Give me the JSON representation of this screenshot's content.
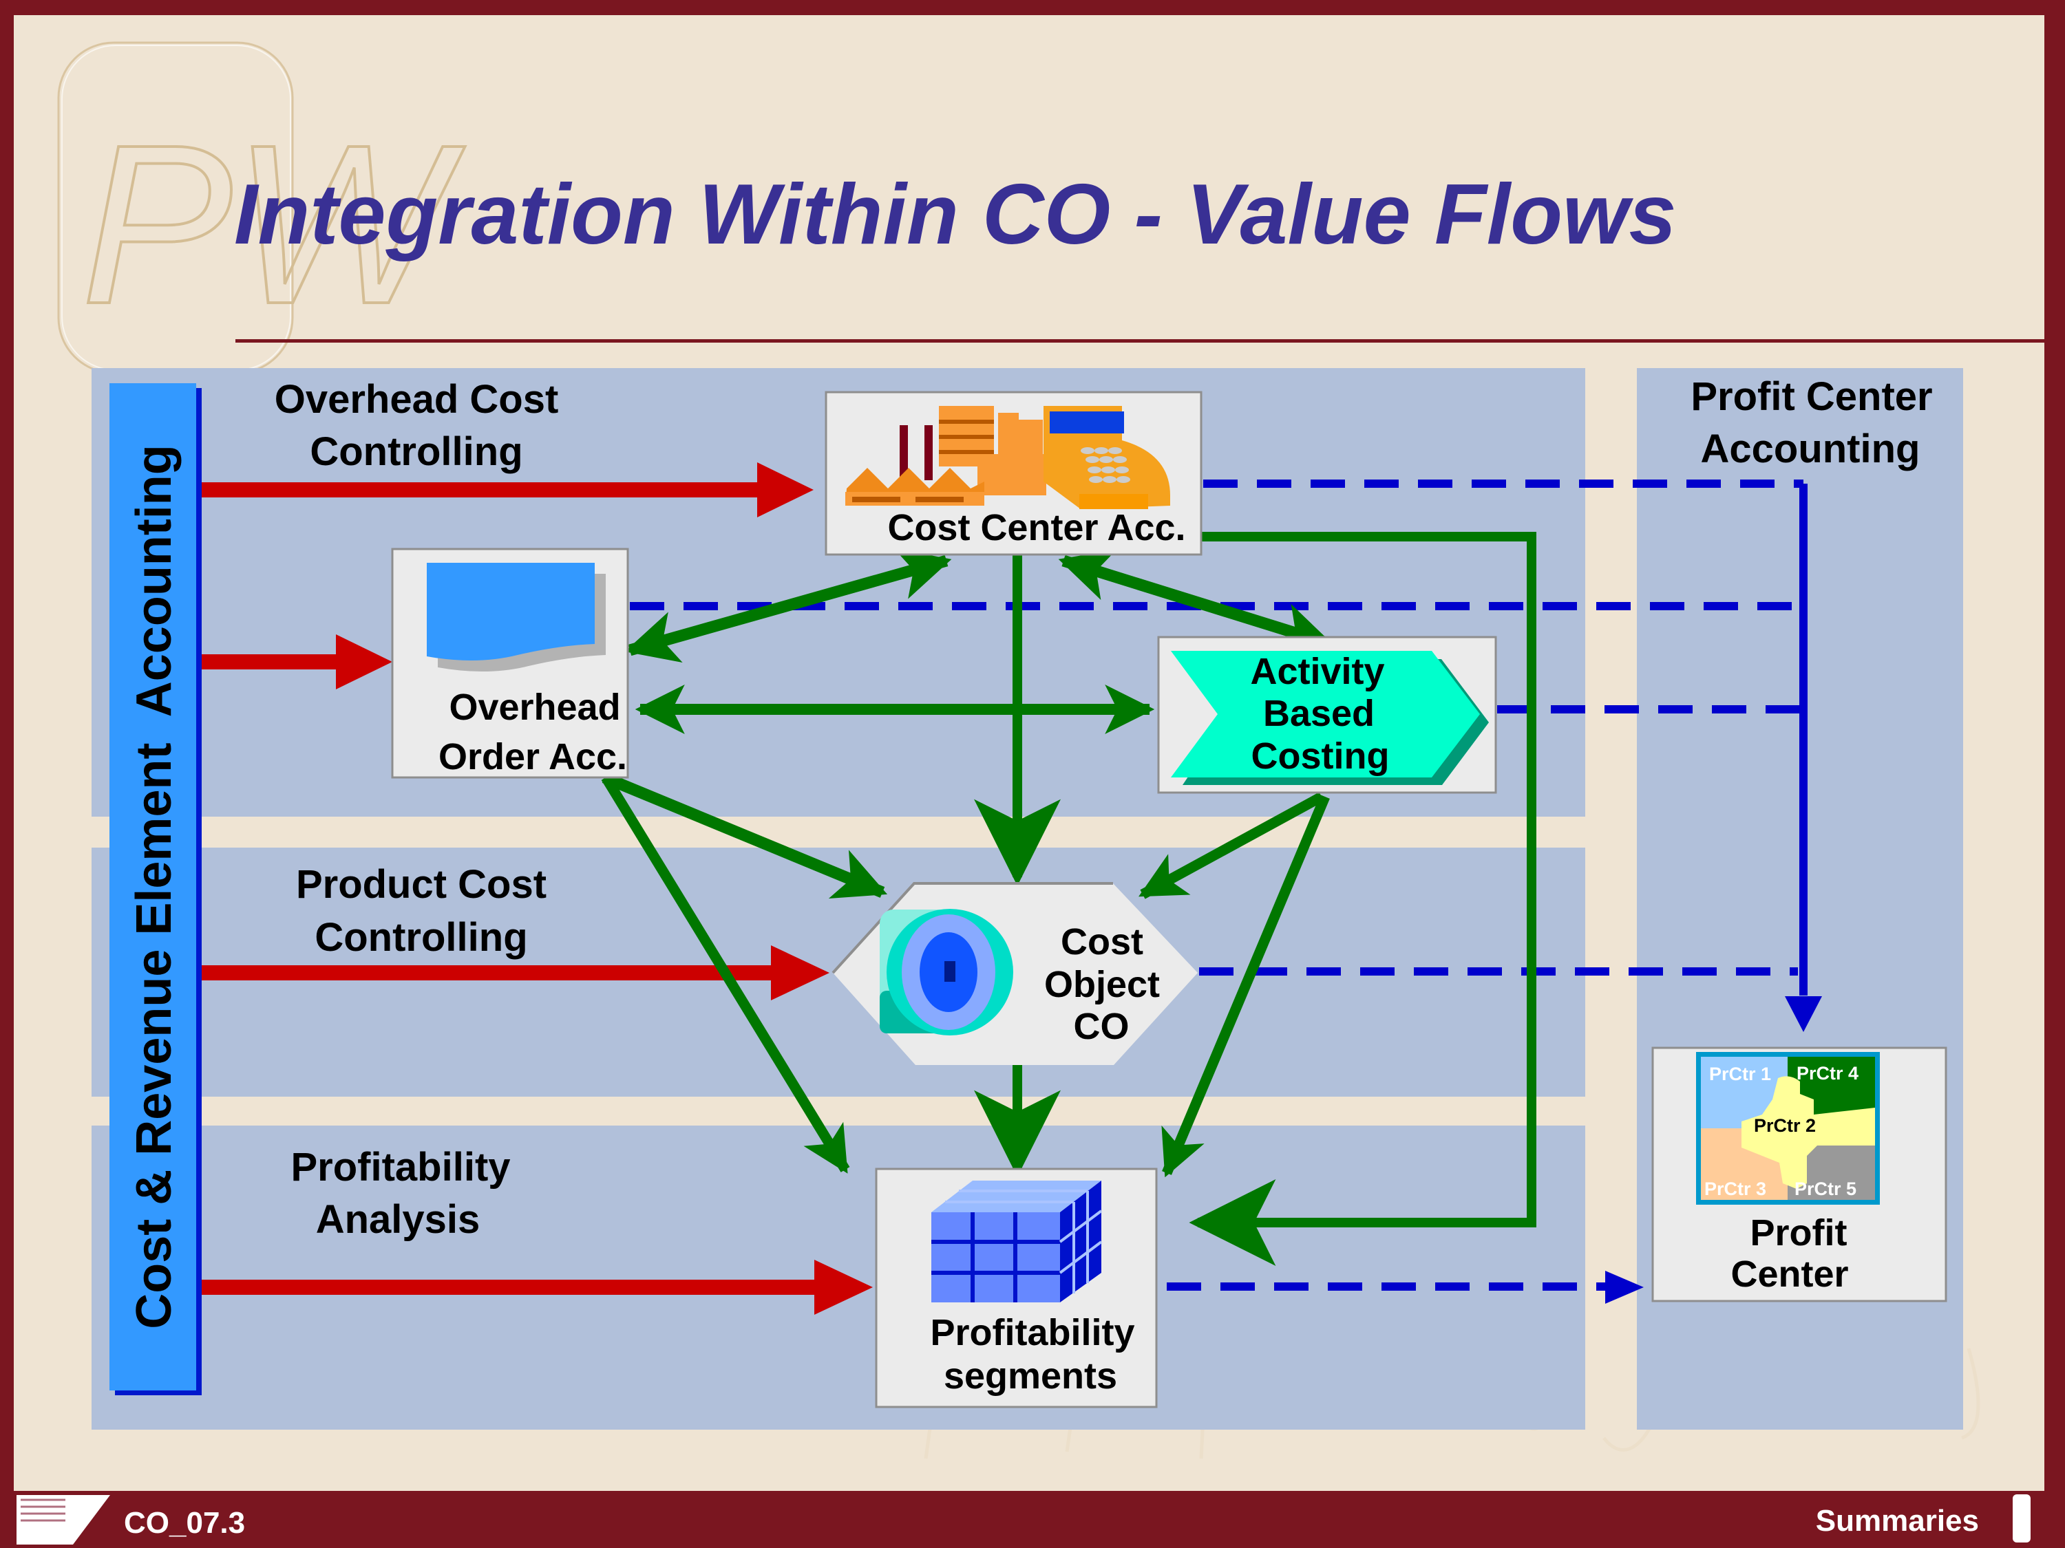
{
  "slide": {
    "title": "Integration Within CO - Value Flows",
    "footer_code": "CO_07.3",
    "footer_section": "Summaries",
    "watermark_logo": "PW"
  },
  "left_bar": {
    "label": "Cost & Revenue Element  Accounting"
  },
  "bands": [
    {
      "id": "overhead",
      "label_line1": "Overhead Cost",
      "label_line2": "Controlling"
    },
    {
      "id": "product",
      "label_line1": "Product Cost",
      "label_line2": "Controlling"
    },
    {
      "id": "profitability",
      "label_line1": "Profitability",
      "label_line2": "Analysis"
    }
  ],
  "right_panel": {
    "label_line1": "Profit Center",
    "label_line2": "Accounting"
  },
  "nodes": {
    "cost_center": {
      "label": "Cost Center Acc.",
      "icon": "factory-cash-register-icon"
    },
    "overhead_order": {
      "label_line1": "Overhead",
      "label_line2": "Order Acc.",
      "icon": "document-icon"
    },
    "abc": {
      "label_line1": "Activity",
      "label_line2": "Based",
      "label_line3": "Costing",
      "icon": "chevron-arrow-icon"
    },
    "cost_object": {
      "label_line1": "Cost",
      "label_line2": "Object",
      "label_line3": "CO",
      "icon": "gear-icon"
    },
    "profitability_segments": {
      "label_line1": "Profitability",
      "label_line2": "segments",
      "icon": "cube-grid-icon"
    },
    "profit_center": {
      "label_line1": "Profit",
      "label_line2": "Center",
      "icon": "puzzle-map-icon",
      "regions": [
        "PrCtr 1",
        "PrCtr 2",
        "PrCtr 3",
        "PrCtr 4",
        "PrCtr 5"
      ]
    }
  },
  "flows": {
    "primary_postings": [
      "Overhead Cost Controlling → Cost Center Acc.",
      "→ Overhead Order Acc.",
      "Product Cost Controlling → Cost Object CO",
      "Profitability Analysis → Profitability segments"
    ],
    "allocations": [
      "Cost Center Acc. ↔ Overhead Order Acc.",
      "Cost Center Acc. ↔ Activity Based Costing",
      "Overhead Order Acc. ↔ Activity Based Costing",
      "Cost Center Acc. → Cost Object CO",
      "Overhead Order Acc. → Cost Object CO",
      "Activity Based Costing → Cost Object CO",
      "Overhead Order Acc. → Profitability segments",
      "Cost Object CO → Profitability segments",
      "Activity Based Costing → Profitability segments",
      "Cost Center Acc. → Profitability segments"
    ],
    "profit_center_updates": [
      "Cost Center Acc. ⇢ Profit Center",
      "Overhead Order Acc. ⇢ Profit Center",
      "Activity Based Costing ⇢ Profit Center",
      "Cost Object CO ⇢ Profit Center",
      "Profitability segments ⇢ Profit Center"
    ]
  },
  "colors": {
    "frame": "#7a1620",
    "background": "#efe4d3",
    "band": "#b1c0da",
    "title": "#393094",
    "primary_arrow": "#cc0000",
    "allocation_arrow": "#007700",
    "profit_center_arrow": "#0000cc",
    "left_bar": "#3399ff",
    "abc_fill": "#00ffcc"
  }
}
